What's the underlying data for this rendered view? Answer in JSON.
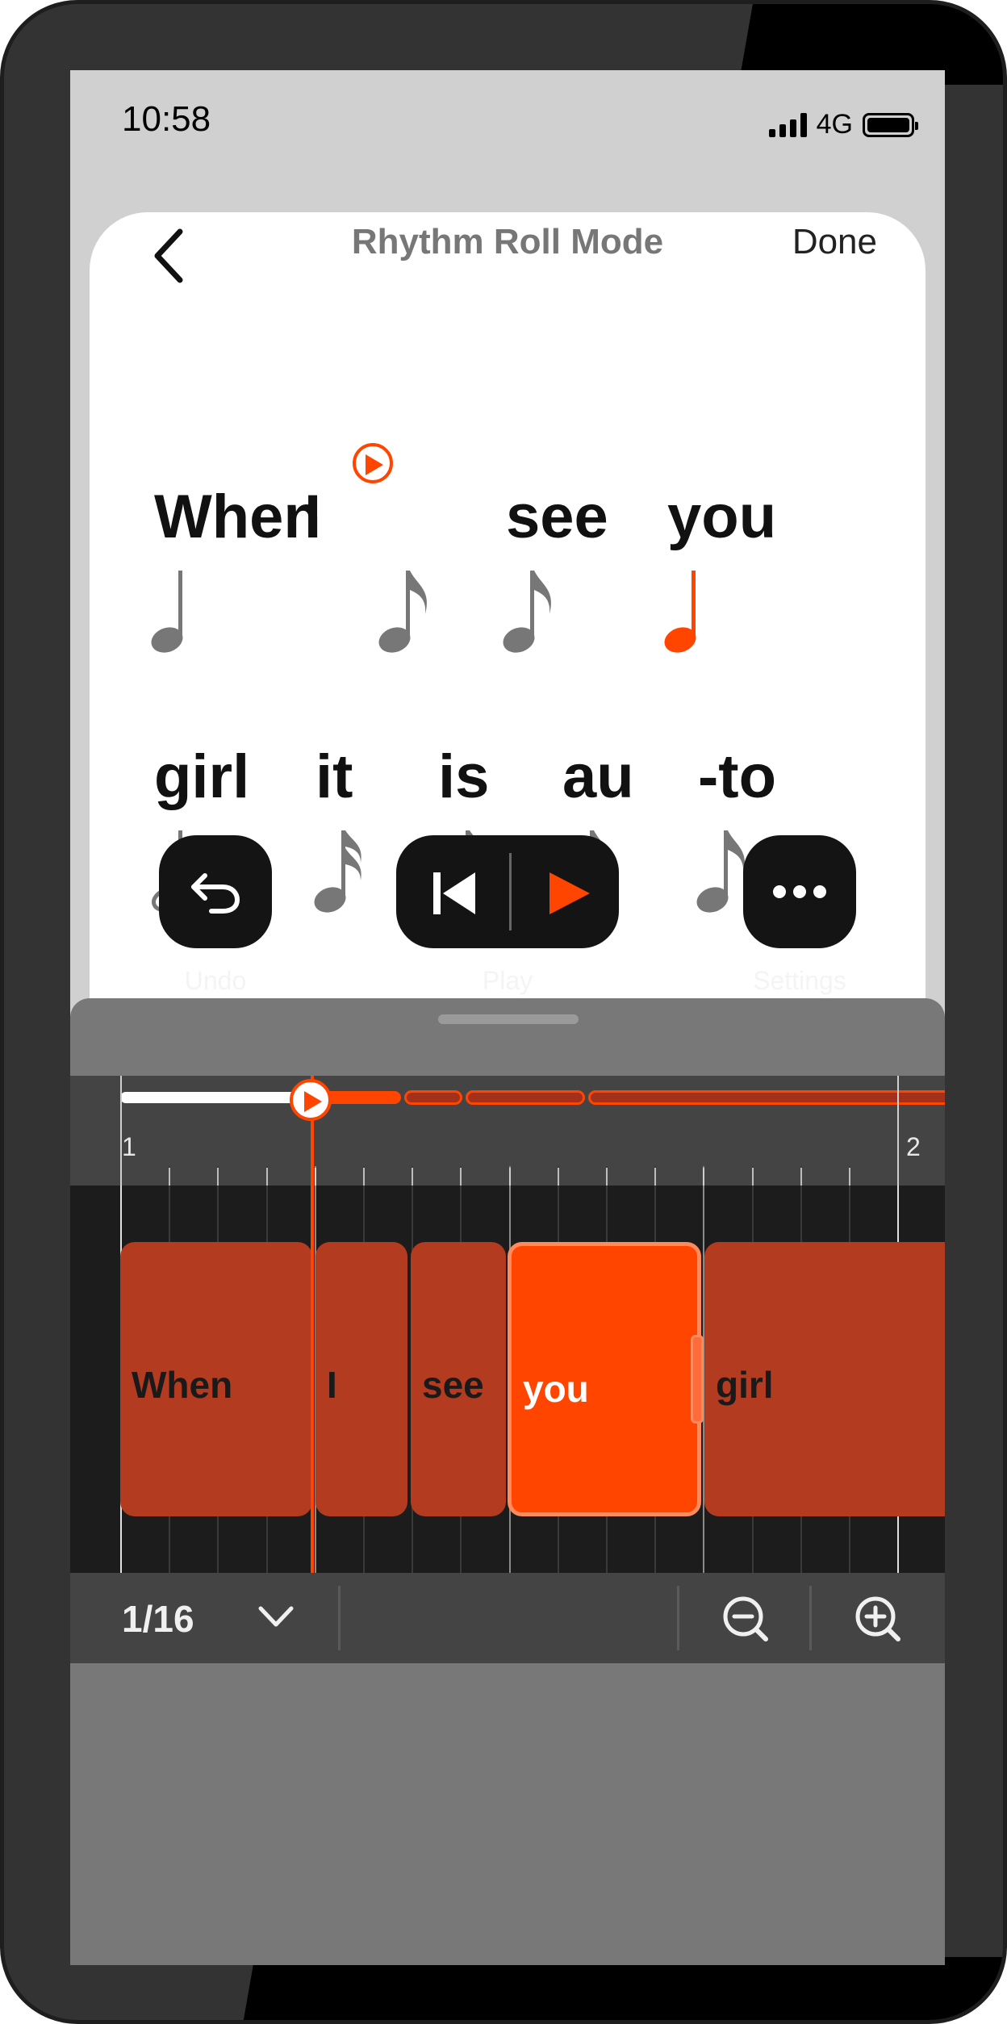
{
  "status_bar": {
    "time": "10:58",
    "network": "4G"
  },
  "header": {
    "title": "Rhythm Roll Mode",
    "done_label": "Done"
  },
  "lyrics": {
    "line1": [
      "When",
      "I",
      "see",
      "you"
    ],
    "line2": [
      "girl",
      "it",
      "is",
      "au",
      "-to"
    ]
  },
  "timeline": {
    "measure_start": "1",
    "measure_next": "2",
    "blocks": [
      "When",
      "I",
      "see",
      "you",
      "girl"
    ]
  },
  "controls": {
    "grid_value": "1/16"
  },
  "actions": {
    "undo_label": "Undo",
    "play_label": "Play",
    "settings_label": "Settings"
  },
  "colors": {
    "accent": "#ff4500",
    "block": "#b33b1f",
    "note_grey": "#777777"
  }
}
